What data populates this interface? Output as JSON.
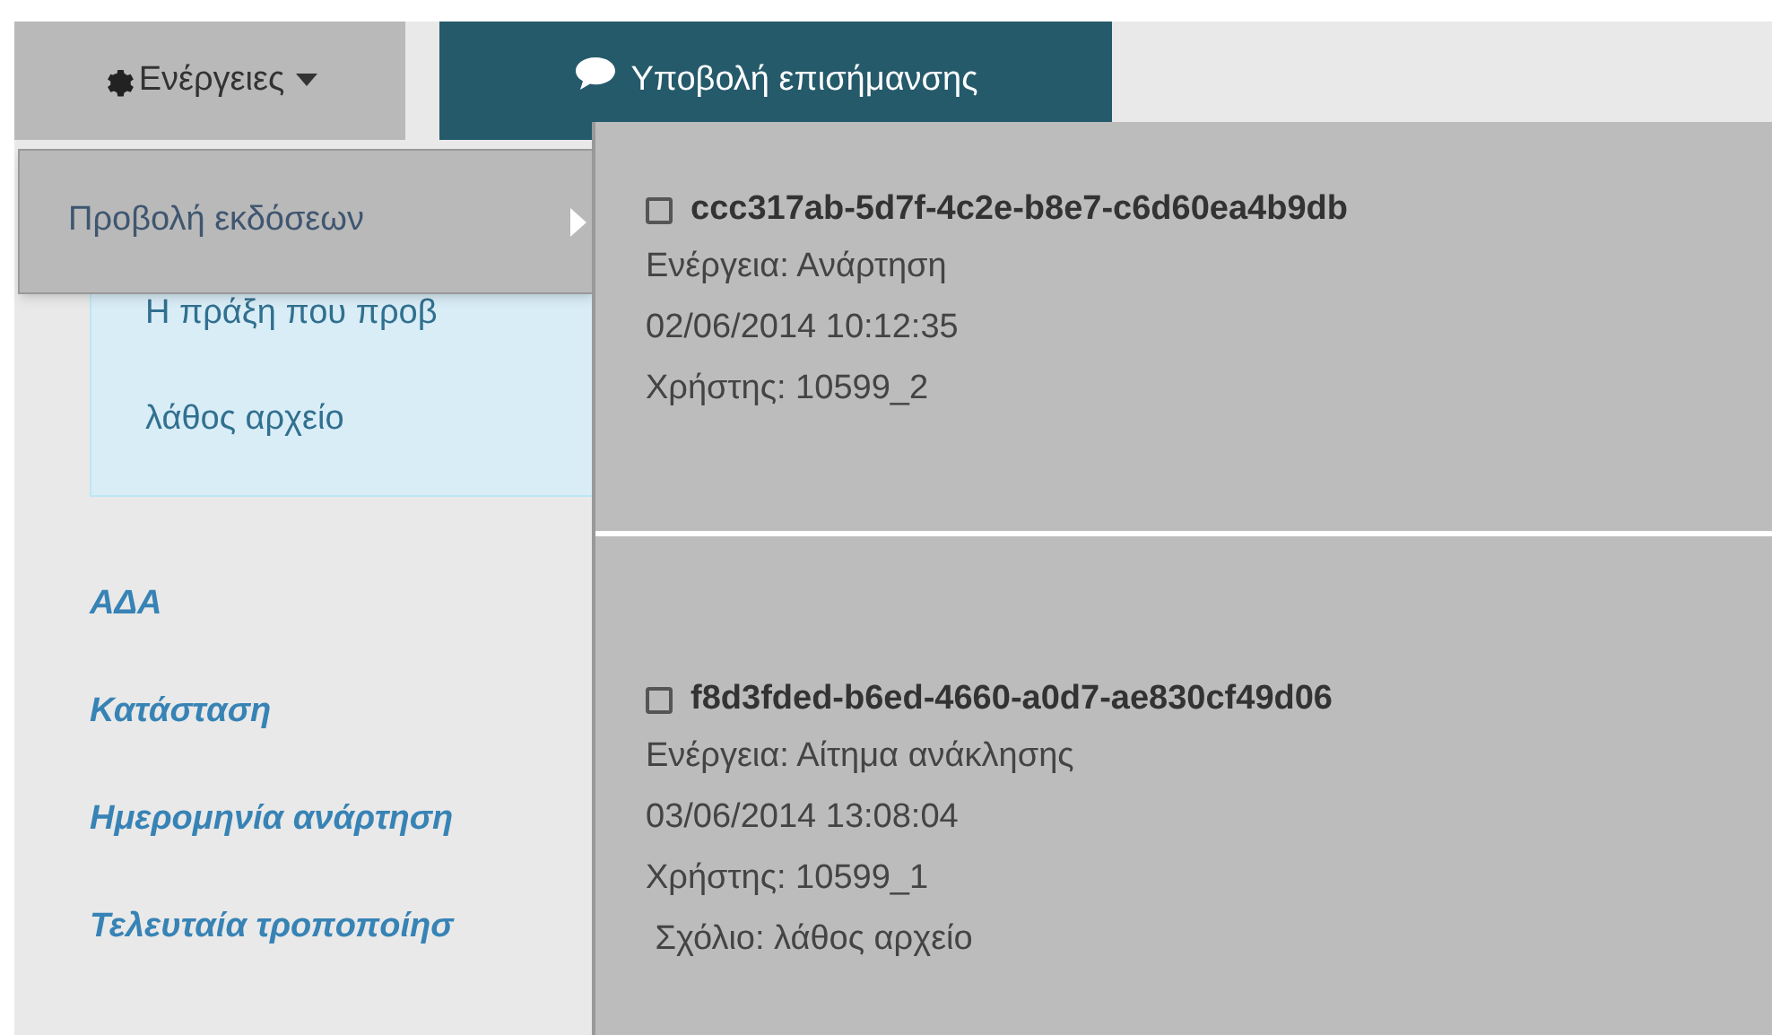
{
  "toolbar": {
    "actions_button": {
      "label": "Ενέργειες",
      "expanded": true
    },
    "submit_button": {
      "label": "Υποβολή επισήμανσης"
    }
  },
  "actions_menu": [
    {
      "label": "Προβολή εκδόσεων",
      "has_submenu": true
    }
  ],
  "versions": [
    {
      "id": "ccc317ab-5d7f-4c2e-b8e7-c6d60ea4b9db",
      "checked": false,
      "lines": [
        "Ενέργεια: Ανάρτηση",
        "02/06/2014 10:12:35",
        "Χρήστης: 10599_2"
      ]
    },
    {
      "id": "f8d3fded-b6ed-4660-a0d7-ae830cf49d06",
      "checked": false,
      "lines": [
        "Ενέργεια: Αίτημα ανάκλησης",
        "03/06/2014 13:08:04",
        "Χρήστης: 10599_1",
        " Σχόλιο: λάθος αρχείο"
      ]
    }
  ],
  "info_box": [
    "Η πράξη που προβ",
    "λάθος αρχείο"
  ],
  "fields": [
    "ΑΔΑ",
    "Κατάσταση",
    "Ημερομηνία ανάρτηση",
    "Τελευταία τροποποίησ"
  ]
}
